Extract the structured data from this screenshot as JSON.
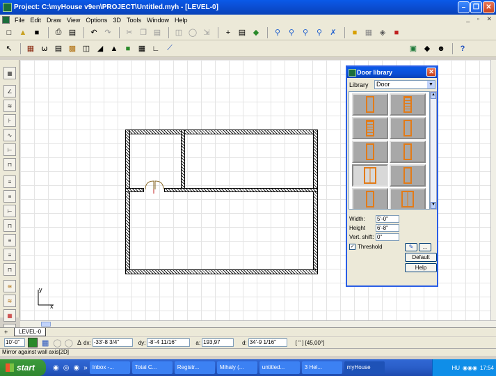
{
  "window": {
    "title": "Project: C:\\myHouse v9en\\PROJECT\\Untitled.myh - [LEVEL-0]"
  },
  "menu": {
    "items": [
      "File",
      "Edit",
      "Draw",
      "View",
      "Options",
      "3D",
      "Tools",
      "Window",
      "Help"
    ]
  },
  "door_library": {
    "title": "Door library",
    "library_label": "Library",
    "library_value": "Door",
    "width_label": "Width:",
    "width_value": "5'-0\"",
    "height_label": "Height",
    "height_value": "6'-8\"",
    "vert_shift_label": "Vert. shift:",
    "vert_shift_value": "0\"",
    "threshold_label": "Threshold",
    "threshold_checked": true,
    "default_label": "Default",
    "help_label": "Help",
    "more_label": "..."
  },
  "canvas": {
    "axis_y": "y",
    "axis_x": "x"
  },
  "tabs": {
    "plus": "+",
    "level": "LEVEL-0"
  },
  "coords": {
    "scale": "10'-0\"",
    "dx_label": "dx:",
    "dx_value": "-33'-8 3/4\"",
    "dy_label": "dy:",
    "dy_value": "-8'-4 11/16\"",
    "angle_label": "a:",
    "angle_value": "193,97",
    "d_label": "d:",
    "d_value": "34'-9 1/16\"",
    "unit_display": "[ \" ]  [45,00°]"
  },
  "status": {
    "text": "Mirror against wall axis[2D]"
  },
  "taskbar": {
    "start": "start",
    "buttons": [
      "Inbox -...",
      "Total C...",
      "Registr...",
      "Mihaly (...",
      "untitled...",
      "3 Hel...",
      "myHouse"
    ],
    "lang": "HU",
    "clock": "17:54"
  }
}
